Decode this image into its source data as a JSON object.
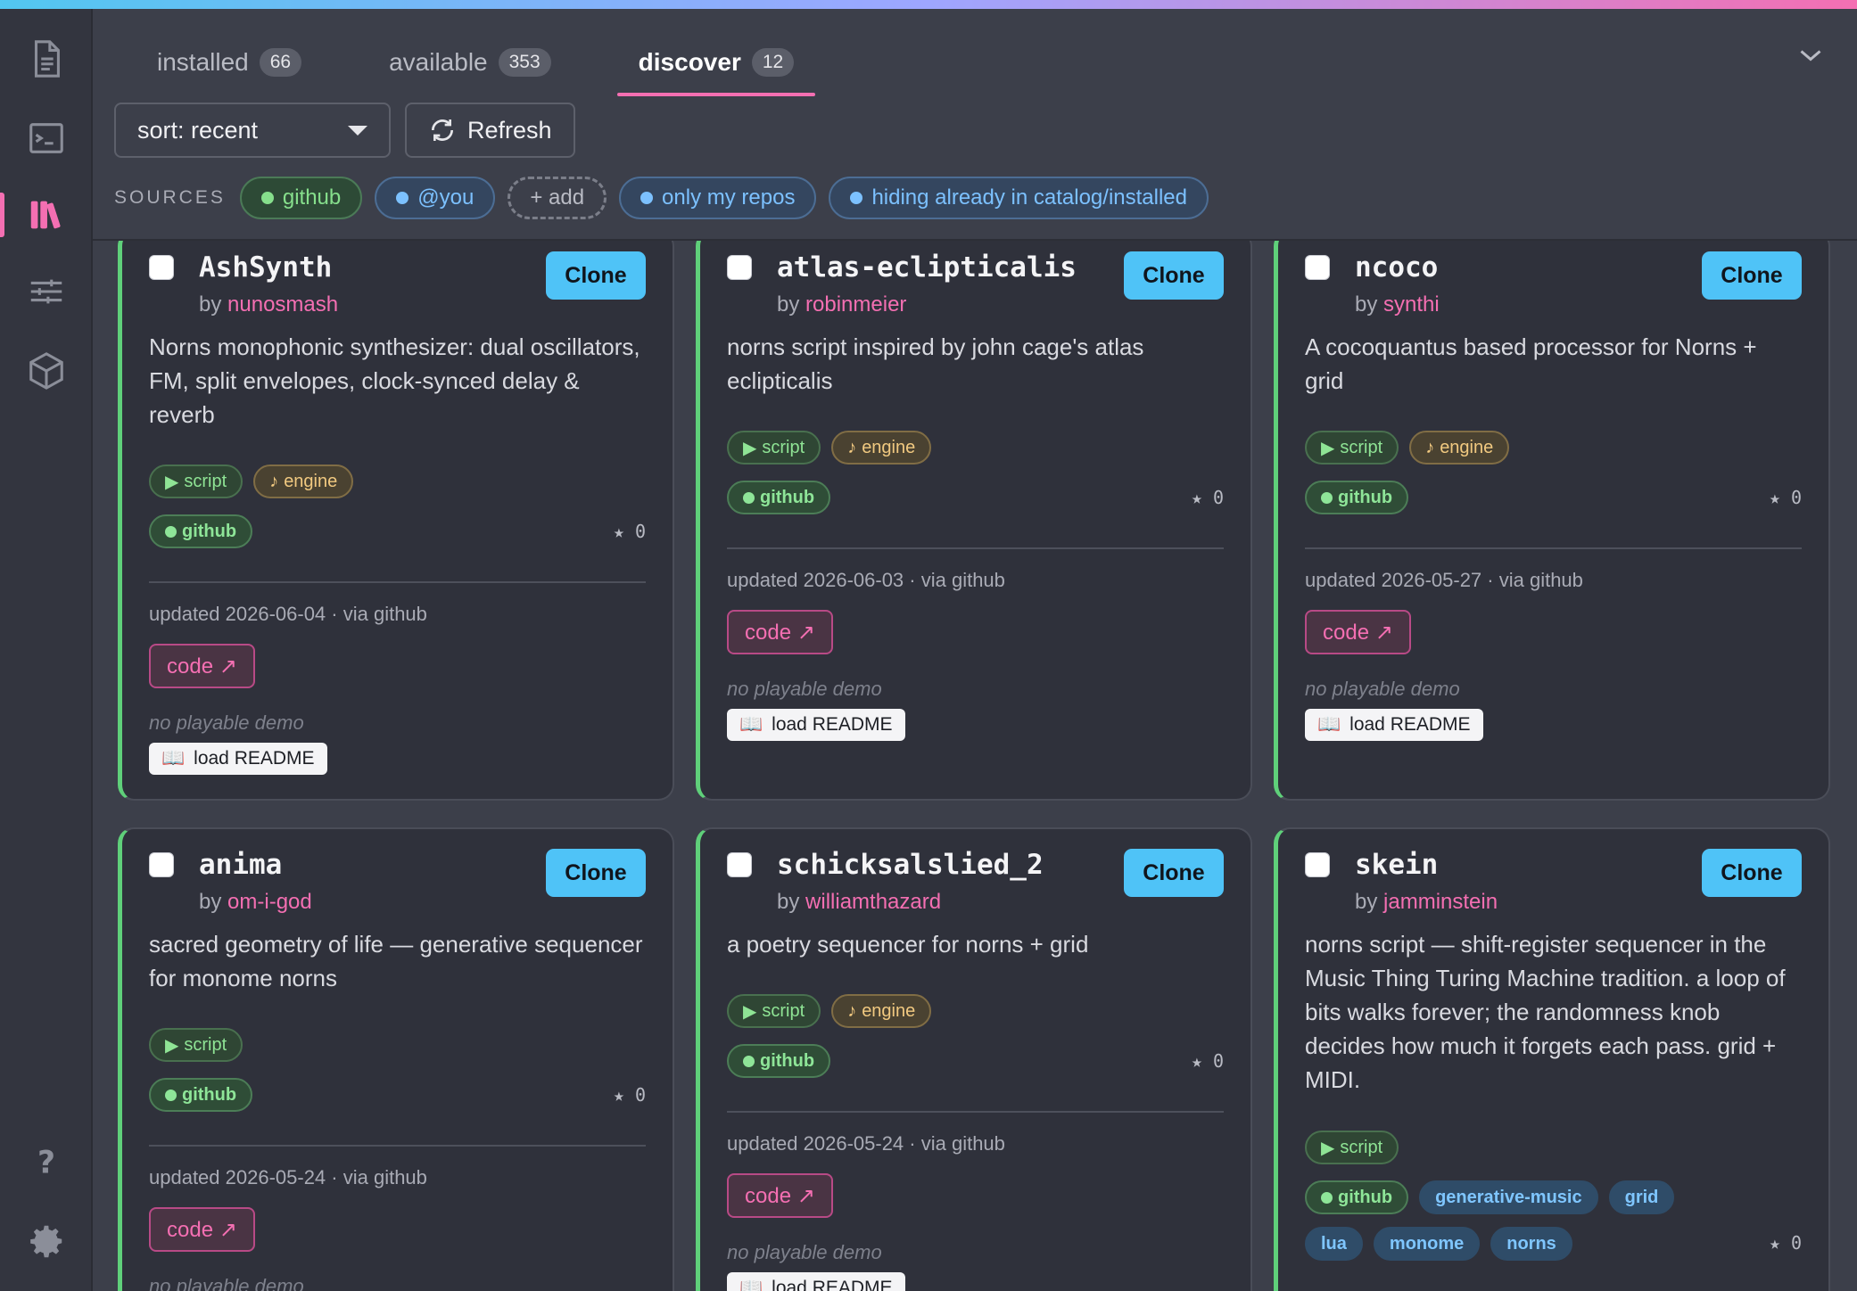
{
  "tabs": [
    {
      "label": "installed",
      "count": "66"
    },
    {
      "label": "available",
      "count": "353"
    },
    {
      "label": "discover",
      "count": "12"
    }
  ],
  "toolbar": {
    "sort_label": "sort: recent",
    "refresh_label": "Refresh"
  },
  "sources": {
    "label": "SOURCES",
    "github": "github",
    "you": "@you",
    "add": "+ add",
    "only_mine": "only my repos",
    "hiding": "hiding already in catalog/installed"
  },
  "common": {
    "clone": "Clone",
    "by": "by",
    "code": "code ↗",
    "no_demo": "no playable demo",
    "load_readme": "load README",
    "script": "script",
    "engine": "engine",
    "github": "github"
  },
  "cards": [
    {
      "name": "AshSynth",
      "author": "nunosmash",
      "desc": "Norns monophonic synthesizer: dual oscillators, FM, split envelopes, clock-synced delay & reverb",
      "stars": "★ 0",
      "updated": "updated 2026-06-04 · via github"
    },
    {
      "name": "atlas-eclipticalis",
      "author": "robinmeier",
      "desc": "norns script inspired by john cage's atlas eclipticalis",
      "stars": "★ 0",
      "updated": "updated 2026-06-03 · via github"
    },
    {
      "name": "ncoco",
      "author": "synthi",
      "desc": "A cocoquantus based processor for Norns + grid",
      "stars": "★ 0",
      "updated": "updated 2026-05-27 · via github"
    },
    {
      "name": "anima",
      "author": "om-i-god",
      "desc": "sacred geometry of life — generative sequencer for monome norns",
      "stars": "★ 0",
      "updated": "updated 2026-05-24 · via github"
    },
    {
      "name": "schicksalslied_2",
      "author": "williamthazard",
      "desc": "a poetry sequencer for norns + grid",
      "stars": "★ 0",
      "updated": "updated 2026-05-24 · via github"
    },
    {
      "name": "skein",
      "author": "jamminstein",
      "desc": "norns script — shift-register sequencer in the Music Thing Turing Machine tradition. a loop of bits walks forever; the randomness knob decides how much it forgets each pass. grid + MIDI.",
      "stars": "★ 0",
      "topics": [
        "generative-music",
        "grid",
        "lua",
        "monome",
        "norns"
      ]
    }
  ],
  "colors": {
    "accent": "#f46fb2",
    "clone": "#4fc3f7",
    "card_border_left": "#5fd07a"
  }
}
